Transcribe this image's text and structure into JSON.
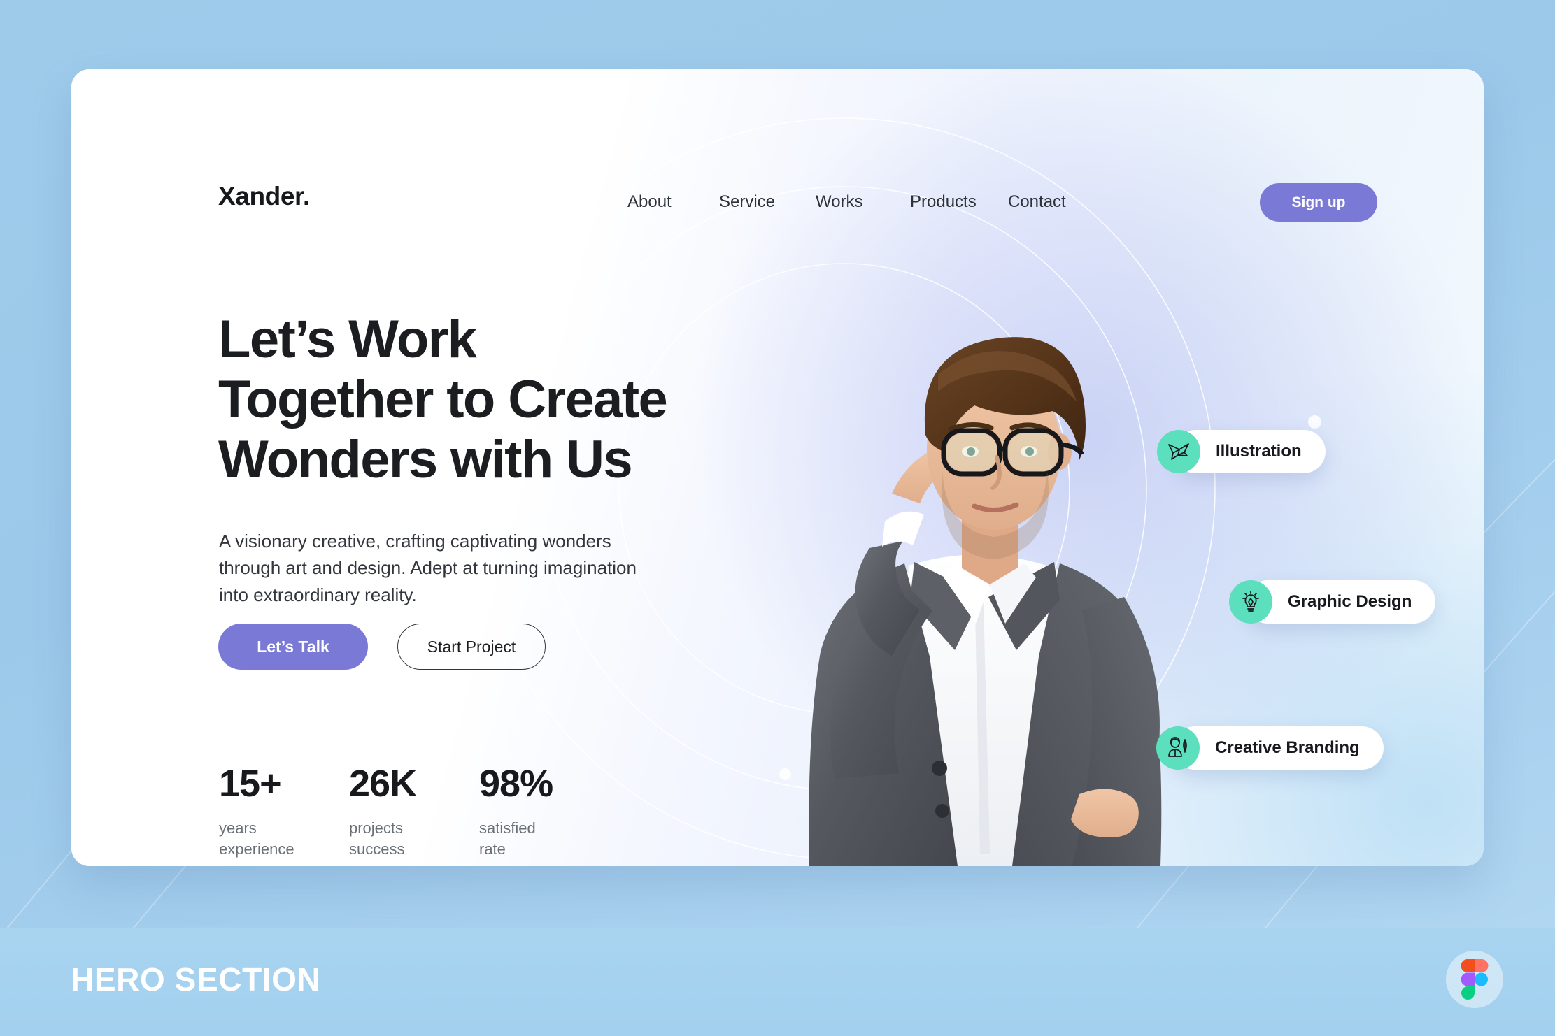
{
  "header": {
    "logo": "Xander.",
    "nav": [
      {
        "label": "About"
      },
      {
        "label": "Service"
      },
      {
        "label": "Works"
      },
      {
        "label": "Products"
      },
      {
        "label": "Contact"
      }
    ],
    "signup_label": "Sign up"
  },
  "hero": {
    "headline_line1": "Let’s Work",
    "headline_line2": "Together to Create",
    "headline_line3": "Wonders with Us",
    "subcopy": "A visionary creative, crafting captivating wonders through art and design. Adept at turning imagination into extraordinary reality.",
    "primary_cta": "Let’s Talk",
    "secondary_cta": "Start Project"
  },
  "stats": [
    {
      "value": "15+",
      "label": "years\nexperience"
    },
    {
      "value": "26K",
      "label": "projects\nsuccess"
    },
    {
      "value": "98%",
      "label": "satisfied\nrate"
    }
  ],
  "badges": [
    {
      "label": "Illustration",
      "icon": "origami-bird-icon"
    },
    {
      "label": "Graphic Design",
      "icon": "lightbulb-pen-icon"
    },
    {
      "label": "Creative Branding",
      "icon": "person-feather-icon"
    }
  ],
  "footer": {
    "title": "HERO SECTION",
    "logo_icon": "figma-logo-icon"
  },
  "colors": {
    "accent_purple": "#7b79d6",
    "badge_mint": "#5bdfbc",
    "page_blue": "#9ecbec",
    "footer_blue": "#a8d4f0",
    "text_dark": "#17191d",
    "text_muted": "#6a7076"
  }
}
